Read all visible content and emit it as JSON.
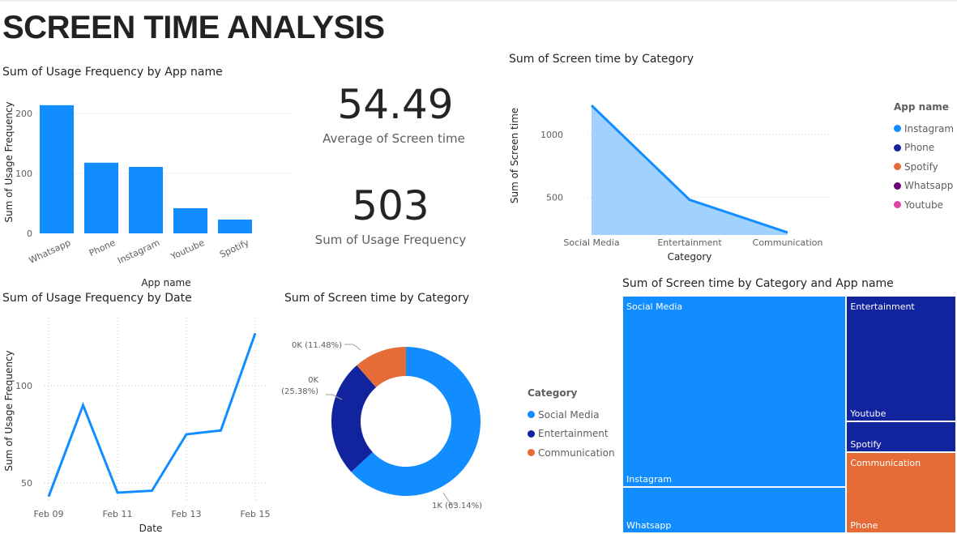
{
  "page": {
    "title": "SCREEN TIME ANALYSIS"
  },
  "bar_visual": {
    "title": "Sum of Usage Frequency by App name"
  },
  "card_avg": {
    "value": "54.49",
    "label": "Average of Screen time"
  },
  "card_sum": {
    "value": "503",
    "label": "Sum of Usage Frequency"
  },
  "area_visual": {
    "title": "Sum of Screen time by Category",
    "legend": {
      "title": "App name",
      "items": [
        {
          "label": "Instagram",
          "color": "#118DFF"
        },
        {
          "label": "Phone",
          "color": "#12239E"
        },
        {
          "label": "Spotify",
          "color": "#E66C37"
        },
        {
          "label": "Whatsapp",
          "color": "#6B007B"
        },
        {
          "label": "Youtube",
          "color": "#E044A7"
        }
      ]
    }
  },
  "line_visual": {
    "title": "Sum of Usage Frequency by Date"
  },
  "donut_visual": {
    "title": "Sum of Screen time by Category",
    "legend": {
      "title": "Category",
      "items": [
        {
          "label": "Social Media",
          "color": "#118DFF"
        },
        {
          "label": "Entertainment",
          "color": "#12239E"
        },
        {
          "label": "Communication",
          "color": "#E66C37"
        }
      ]
    }
  },
  "treemap_visual": {
    "title": "Sum of Screen time by Category and App name"
  },
  "chart_data": [
    {
      "type": "bar",
      "title": "Sum of Usage Frequency by App name",
      "xlabel": "App name",
      "ylabel": "Sum of Usage Frequency",
      "categories": [
        "Whatsapp",
        "Phone",
        "Instagram",
        "Youtube",
        "Spotify"
      ],
      "values": [
        214,
        118,
        111,
        42,
        23
      ],
      "ylim": [
        0,
        230
      ],
      "yticks": [
        0,
        100,
        200
      ],
      "color": "#118DFF",
      "grid": true
    },
    {
      "type": "area",
      "title": "Sum of Screen time by Category",
      "xlabel": "Category",
      "ylabel": "Sum of Screen time",
      "categories": [
        "Social Media",
        "Entertainment",
        "Communication"
      ],
      "values": [
        1230,
        480,
        220
      ],
      "ylim": [
        200,
        1250
      ],
      "yticks": [
        500,
        1000
      ],
      "color": "#118DFF",
      "fill": "#A0D1FF",
      "grid": true
    },
    {
      "type": "line",
      "title": "Sum of Usage Frequency by Date",
      "xlabel": "Date",
      "ylabel": "Sum of Usage Frequency",
      "x": [
        "Feb 09",
        "Feb 10",
        "Feb 11",
        "Feb 12",
        "Feb 13",
        "Feb 14",
        "Feb 15"
      ],
      "xticks": [
        "Feb 09",
        "Feb 11",
        "Feb 13",
        "Feb 15"
      ],
      "values": [
        43,
        90,
        45,
        46,
        75,
        77,
        127
      ],
      "ylim": [
        40,
        135
      ],
      "yticks": [
        50,
        100
      ],
      "color": "#118DFF",
      "grid": true
    },
    {
      "type": "pie",
      "title": "Sum of Screen time by Category",
      "labels": [
        "Social Media",
        "Entertainment",
        "Communication"
      ],
      "values": [
        63.14,
        25.38,
        11.48
      ],
      "data_labels": [
        "1K (63.14%)",
        "0K\n(25.38%)",
        "0K (11.48%)"
      ],
      "colors": [
        "#118DFF",
        "#12239E",
        "#E66C37"
      ],
      "legend": "left"
    },
    {
      "type": "treemap",
      "title": "Sum of Screen time by Category and App name",
      "groups": [
        {
          "name": "Social Media",
          "color": "#118DFF",
          "children": [
            {
              "name": "Instagram",
              "value": 1085
            },
            {
              "name": "Whatsapp",
              "value": 260
            }
          ]
        },
        {
          "name": "Entertainment",
          "color": "#12239E",
          "children": [
            {
              "name": "Youtube",
              "value": 350
            },
            {
              "name": "Spotify",
              "value": 85
            }
          ]
        },
        {
          "name": "Communication",
          "color": "#E66C37",
          "children": [
            {
              "name": "Phone",
              "value": 225
            }
          ]
        }
      ]
    }
  ]
}
